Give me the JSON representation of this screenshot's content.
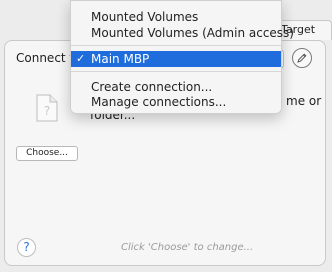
{
  "tabs": {
    "target_label": "Target"
  },
  "connect": {
    "label": "Connect to"
  },
  "menu": {
    "items": [
      {
        "label": "Mounted Volumes"
      },
      {
        "label": "Mounted Volumes (Admin access)"
      },
      {
        "label": "Main MBP",
        "checked": true,
        "check_glyph": "✓"
      },
      {
        "label": "Create connection..."
      },
      {
        "label": "Manage connections..."
      }
    ]
  },
  "file": {
    "line1": "me or",
    "line2": "folder..."
  },
  "buttons": {
    "choose_label": "Choose...",
    "help_label": "?"
  },
  "status": {
    "text": "Click 'Choose' to change..."
  },
  "icons": {
    "edit": "pencil-icon",
    "file": "document-icon"
  },
  "colors": {
    "accent": "#1f6ddd",
    "help_blue": "#2f6fd6",
    "window_bg": "#ececec",
    "panel_bg": "#f6f6f6"
  }
}
